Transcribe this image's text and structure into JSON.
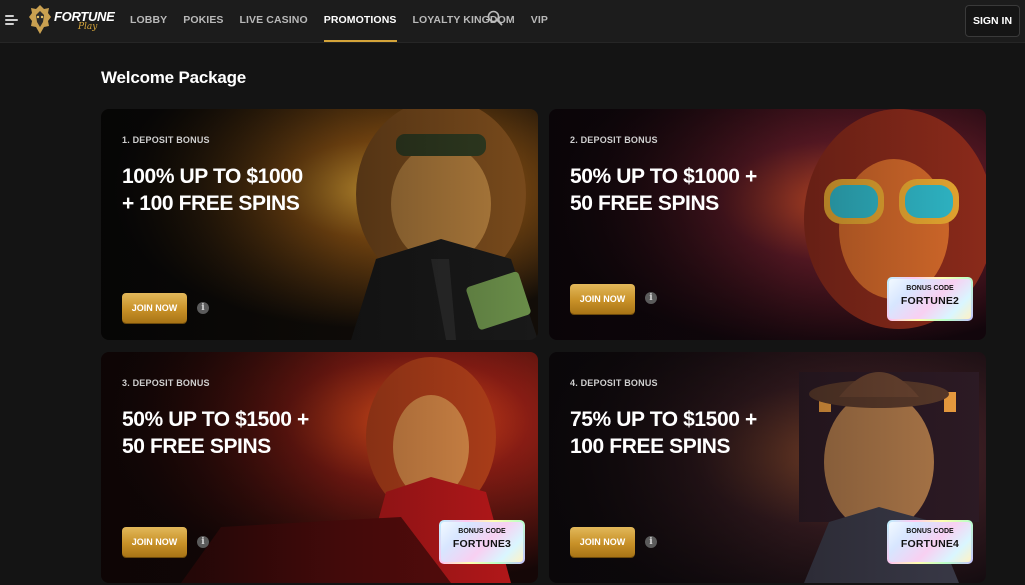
{
  "header": {
    "logo": {
      "word": "FORTUNE",
      "sub": "Play"
    },
    "nav": [
      {
        "label": "Lobby",
        "active": false
      },
      {
        "label": "Pokies",
        "active": false
      },
      {
        "label": "Live Casino",
        "active": false
      },
      {
        "label": "Promotions",
        "active": true
      },
      {
        "label": "Loyalty Kingdom",
        "active": false
      },
      {
        "label": "VIP",
        "active": false
      }
    ],
    "signin_label": "SIGN IN"
  },
  "page": {
    "title": "Welcome Package"
  },
  "cards": [
    {
      "step": "1. Deposit Bonus",
      "line1": "100% up to $1000",
      "line2": "+ 100 free spins",
      "join_label": "Join now",
      "bonus_code": null
    },
    {
      "step": "2. Deposit Bonus",
      "line1": "50% up to $1000 +",
      "line2": "50 free spins",
      "join_label": "Join now",
      "bonus_code": {
        "label": "Bonus code",
        "value": "FORTUNE2"
      }
    },
    {
      "step": "3. Deposit Bonus",
      "line1": "50% up to $1500 +",
      "line2": "50 free spins",
      "join_label": "Join now",
      "bonus_code": {
        "label": "Bonus code",
        "value": "FORTUNE3"
      }
    },
    {
      "step": "4. Deposit Bonus",
      "line1": "75% up to $1500 +",
      "line2": "100 free spins",
      "join_label": "Join now",
      "bonus_code": {
        "label": "Bonus code",
        "value": "FORTUNE4"
      }
    }
  ],
  "colors": {
    "accent_gold": "#d4a43a",
    "page_bg": "#141414",
    "topbar_bg": "#1c1c1c"
  },
  "icons": [
    "hamburger-menu-icon",
    "lion-logo-icon",
    "search-icon",
    "info-icon"
  ]
}
